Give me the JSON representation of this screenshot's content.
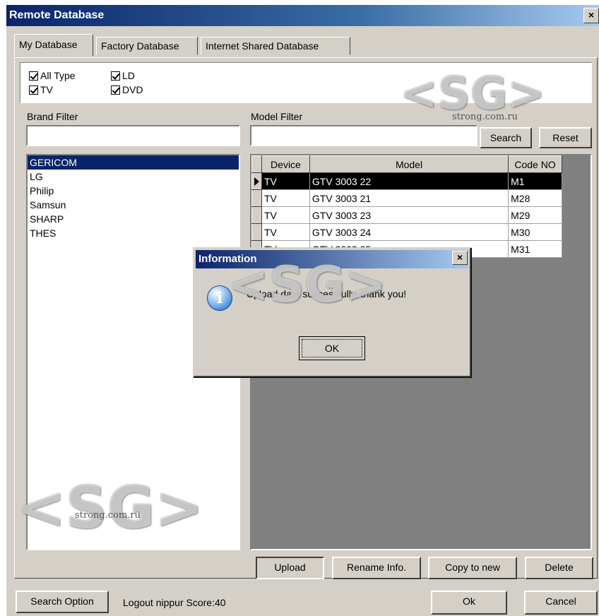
{
  "window": {
    "title": "Remote Database",
    "close": "×"
  },
  "tabs": [
    "My Database",
    "Factory Database",
    "Internet Shared Database"
  ],
  "types": {
    "all": "All Type",
    "tv": "TV",
    "ld": "LD",
    "dvd": "DVD"
  },
  "filters": {
    "brand_label": "Brand Filter",
    "brand_value": "",
    "model_label": "Model Filter",
    "model_value": "",
    "search": "Search",
    "reset": "Reset"
  },
  "brands": [
    "GERICOM",
    "LG",
    "Philip",
    "Samsun",
    "SHARP",
    "THES"
  ],
  "selected_brand": "GERICOM",
  "grid": {
    "columns": [
      "Device",
      "Model",
      "Code NO"
    ],
    "rows": [
      [
        "TV",
        "GTV 3003 22",
        "M1"
      ],
      [
        "TV",
        "GTV 3003 21",
        "M28"
      ],
      [
        "TV",
        "GTV 3003 23",
        "M29"
      ],
      [
        "TV",
        "GTV 3003 24",
        "M30"
      ],
      [
        "TV",
        "GTV 3003 25",
        "M31"
      ]
    ]
  },
  "actions": {
    "upload": "Upload",
    "rename": "Rename Info.",
    "copy": "Copy to new",
    "delete": "Delete"
  },
  "footer": {
    "search_option": "Search Option",
    "status": "Logout nippur Score:40",
    "ok": "Ok",
    "cancel": "Cancel"
  },
  "dialog": {
    "title": "Information",
    "close": "×",
    "message": "Upload data successfully, thank you!",
    "ok": "OK",
    "icon": "info-icon"
  },
  "watermark": {
    "logo": "<SG>",
    "site": "strong.com.ru"
  }
}
